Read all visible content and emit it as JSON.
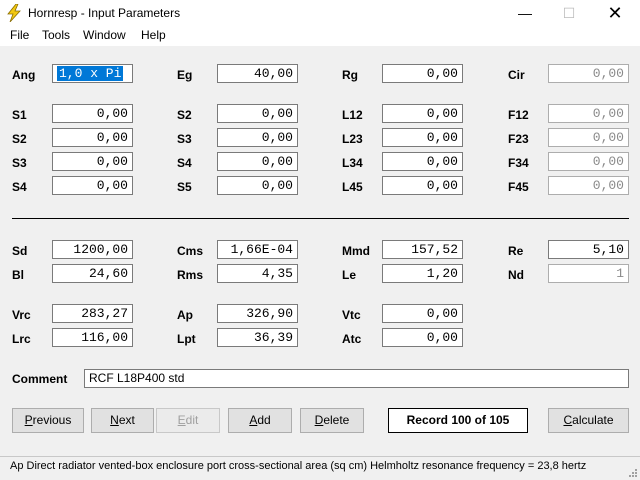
{
  "window": {
    "title": "Hornresp - Input Parameters",
    "minimize": "—",
    "maximize": "☐",
    "close": "✕"
  },
  "menu": {
    "file": "File",
    "tools": "Tools",
    "window": "Window",
    "help": "Help"
  },
  "row1": [
    {
      "label": "Ang",
      "value": "1,0 x Pi",
      "state": "selected"
    },
    {
      "label": "Eg",
      "value": "40,00"
    },
    {
      "label": "Rg",
      "value": "0,00"
    },
    {
      "label": "Cir",
      "value": "0,00",
      "state": "disabled"
    }
  ],
  "grid": [
    [
      {
        "label": "S1",
        "value": "0,00"
      },
      {
        "label": "S2",
        "value": "0,00"
      },
      {
        "label": "L12",
        "value": "0,00"
      },
      {
        "label": "F12",
        "value": "0,00",
        "state": "disabled"
      }
    ],
    [
      {
        "label": "S2",
        "value": "0,00"
      },
      {
        "label": "S3",
        "value": "0,00"
      },
      {
        "label": "L23",
        "value": "0,00"
      },
      {
        "label": "F23",
        "value": "0,00",
        "state": "disabled"
      }
    ],
    [
      {
        "label": "S3",
        "value": "0,00"
      },
      {
        "label": "S4",
        "value": "0,00"
      },
      {
        "label": "L34",
        "value": "0,00"
      },
      {
        "label": "F34",
        "value": "0,00",
        "state": "disabled"
      }
    ],
    [
      {
        "label": "S4",
        "value": "0,00"
      },
      {
        "label": "S5",
        "value": "0,00"
      },
      {
        "label": "L45",
        "value": "0,00"
      },
      {
        "label": "F45",
        "value": "0,00",
        "state": "disabled"
      }
    ]
  ],
  "driver": [
    [
      {
        "label": "Sd",
        "value": "1200,00"
      },
      {
        "label": "Cms",
        "value": "1,66E-04"
      },
      {
        "label": "Mmd",
        "value": "157,52"
      },
      {
        "label": "Re",
        "value": "5,10"
      }
    ],
    [
      {
        "label": "Bl",
        "value": "24,60"
      },
      {
        "label": "Rms",
        "value": "4,35"
      },
      {
        "label": "Le",
        "value": "1,20"
      },
      {
        "label": "Nd",
        "value": "1",
        "state": "disabled"
      }
    ]
  ],
  "chamber": [
    [
      {
        "label": "Vrc",
        "value": "283,27"
      },
      {
        "label": "Ap",
        "value": "326,90"
      },
      {
        "label": "Vtc",
        "value": "0,00"
      }
    ],
    [
      {
        "label": "Lrc",
        "value": "116,00"
      },
      {
        "label": "Lpt",
        "value": "36,39"
      },
      {
        "label": "Atc",
        "value": "0,00"
      }
    ]
  ],
  "comment": {
    "label": "Comment",
    "value": "RCF L18P400 std"
  },
  "buttons": {
    "previous": {
      "pre": "",
      "u": "P",
      "post": "revious"
    },
    "next": {
      "pre": "",
      "u": "N",
      "post": "ext"
    },
    "edit": {
      "pre": "",
      "u": "E",
      "post": "dit"
    },
    "add": {
      "pre": "",
      "u": "A",
      "post": "dd"
    },
    "delete": {
      "pre": "",
      "u": "D",
      "post": "elete"
    },
    "calculate": {
      "pre": "",
      "u": "C",
      "post": "alculate"
    }
  },
  "record": "Record 100 of 105",
  "status": "Ap   Direct radiator vented-box enclosure port cross-sectional area  (sq cm)   Helmholtz resonance frequency = 23,8 hertz",
  "colors": {
    "selection": "#0078d7",
    "client_bg": "#f0f0f0",
    "icon_yellow": "#f2c811"
  },
  "icons": {
    "app": "lightning-bolt-icon"
  }
}
